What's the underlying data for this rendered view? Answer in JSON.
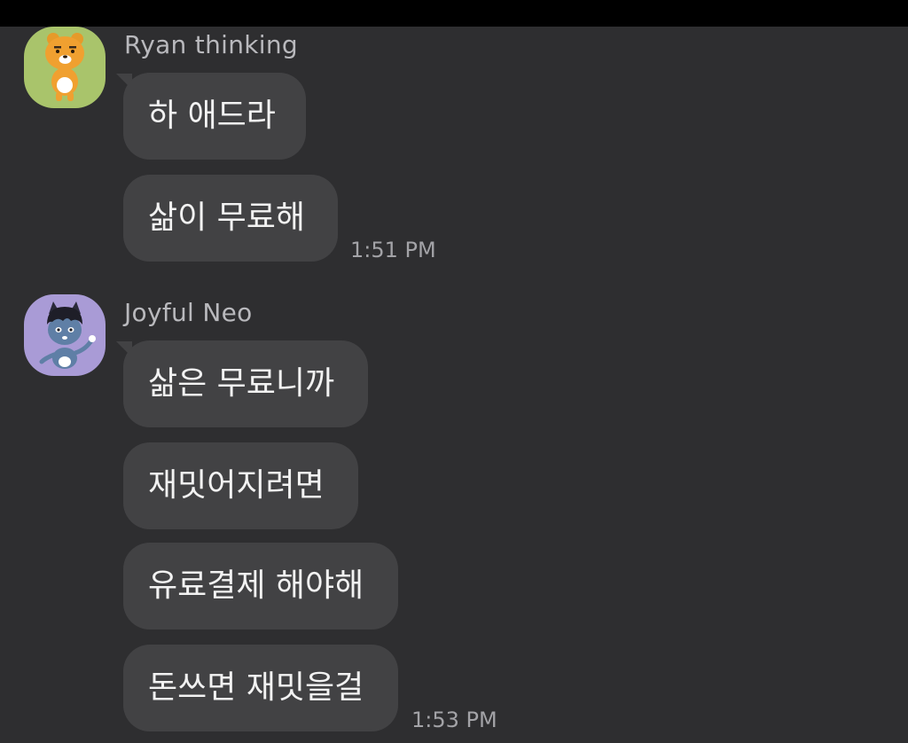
{
  "colors": {
    "background": "#2e2e30",
    "bubble": "#424244",
    "bubble_text": "#f2f2f2",
    "sender_text": "#b9b9bd",
    "time_text": "#a3a3a7",
    "ryan_avatar_bg": "#a9c46b",
    "neo_avatar_bg": "#a99bd6"
  },
  "messages": [
    {
      "sender": "Ryan thinking",
      "avatar_icon": "ryan-character-icon",
      "bubbles": [
        "하 애드라",
        "삶이 무료해"
      ],
      "time": "1:51 PM"
    },
    {
      "sender": "Joyful Neo",
      "avatar_icon": "neo-character-icon",
      "bubbles": [
        "삶은 무료니까",
        "재밋어지려면",
        "유료결제 해야해",
        "돈쓰면 재밋을걸"
      ],
      "time": "1:53 PM"
    }
  ]
}
